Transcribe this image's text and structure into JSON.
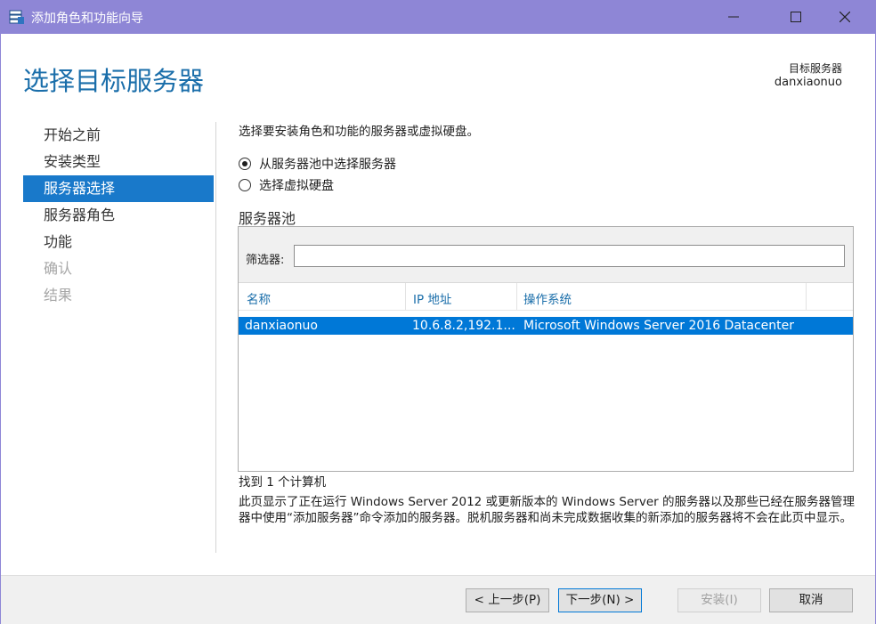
{
  "window": {
    "title": "添加角色和功能向导",
    "minimize_icon": "minimize-icon",
    "maximize_icon": "maximize-icon",
    "close_icon": "close-icon",
    "app_icon": "server-wizard-icon"
  },
  "header": {
    "page_title": "选择目标服务器",
    "destination_label": "目标服务器",
    "destination_value": "danxiaonuo"
  },
  "nav": {
    "items": [
      {
        "label": "开始之前",
        "state": "normal"
      },
      {
        "label": "安装类型",
        "state": "normal"
      },
      {
        "label": "服务器选择",
        "state": "active"
      },
      {
        "label": "服务器角色",
        "state": "normal"
      },
      {
        "label": "功能",
        "state": "normal"
      },
      {
        "label": "确认",
        "state": "disabled"
      },
      {
        "label": "结果",
        "state": "disabled"
      }
    ]
  },
  "content": {
    "intro": "选择要安装角色和功能的服务器或虚拟硬盘。",
    "option_pool": "从服务器池中选择服务器",
    "option_vhd": "选择虚拟硬盘",
    "selected_option": "pool",
    "pool_title": "服务器池",
    "filter_label": "筛选器:",
    "filter_value": "",
    "columns": [
      "名称",
      "IP 地址",
      "操作系统"
    ],
    "rows": [
      {
        "name": "danxiaonuo",
        "ip": "10.6.8.2,192.1...",
        "os": "Microsoft Windows Server 2016 Datacenter"
      }
    ],
    "found_text": "找到 1 个计算机",
    "note": "此页显示了正在运行 Windows Server 2012 或更新版本的 Windows Server 的服务器以及那些已经在服务器管理器中使用“添加服务器”命令添加的服务器。脱机服务器和尚未完成数据收集的新添加的服务器将不会在此页中显示。"
  },
  "buttons": {
    "previous": "< 上一步(P)",
    "next": "下一步(N) >",
    "install": "安装(I)",
    "cancel": "取消"
  },
  "colors": {
    "titlebar": "#8e86d6",
    "accent": "#1979ca",
    "selection": "#0078d7",
    "title_text": "#1a6eaa"
  }
}
